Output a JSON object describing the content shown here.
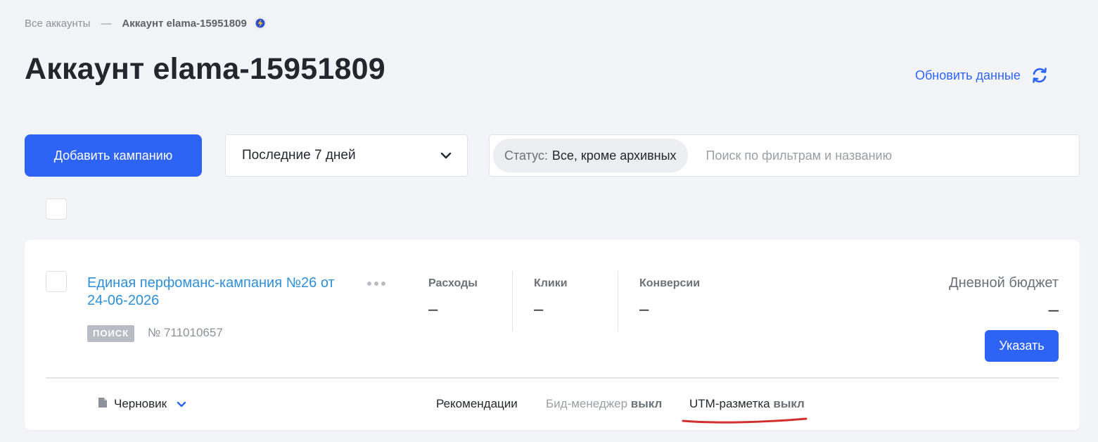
{
  "breadcrumb": {
    "all_accounts": "Все аккаунты",
    "separator": "—",
    "current": "Аккаунт elama-15951809",
    "badge_icon": "lightning-badge-icon"
  },
  "header": {
    "title": "Аккаунт elama-15951809",
    "refresh_label": "Обновить данные",
    "refresh_icon": "refresh-icon"
  },
  "toolbar": {
    "add_campaign_label": "Добавить кампанию",
    "period_value": "Последние 7 дней",
    "status_label": "Статус:",
    "status_value": "Все, кроме архивных",
    "search_placeholder": "Поиск по фильтрам и названию"
  },
  "campaign": {
    "name": "Единая перфоманс-кампания №26 от 24-06-2026",
    "tag": "ПОИСК",
    "id": "№ 711010657",
    "metrics": [
      {
        "label": "Расходы",
        "value": "–"
      },
      {
        "label": "Клики",
        "value": "–"
      },
      {
        "label": "Конверсии",
        "value": "–"
      }
    ],
    "budget_label": "Дневной бюджет",
    "budget_value": "–",
    "set_button": "Указать",
    "status": "Черновик",
    "recommendations": "Рекомендации",
    "bid_manager": "Бид-менеджер",
    "bid_manager_state": "выкл",
    "utm": "UTM-разметка",
    "utm_state": "выкл"
  },
  "colors": {
    "accent": "#2e64f5",
    "link": "#2f8fd8",
    "background": "#f3f4f7",
    "annotation": "#d32f2f"
  }
}
